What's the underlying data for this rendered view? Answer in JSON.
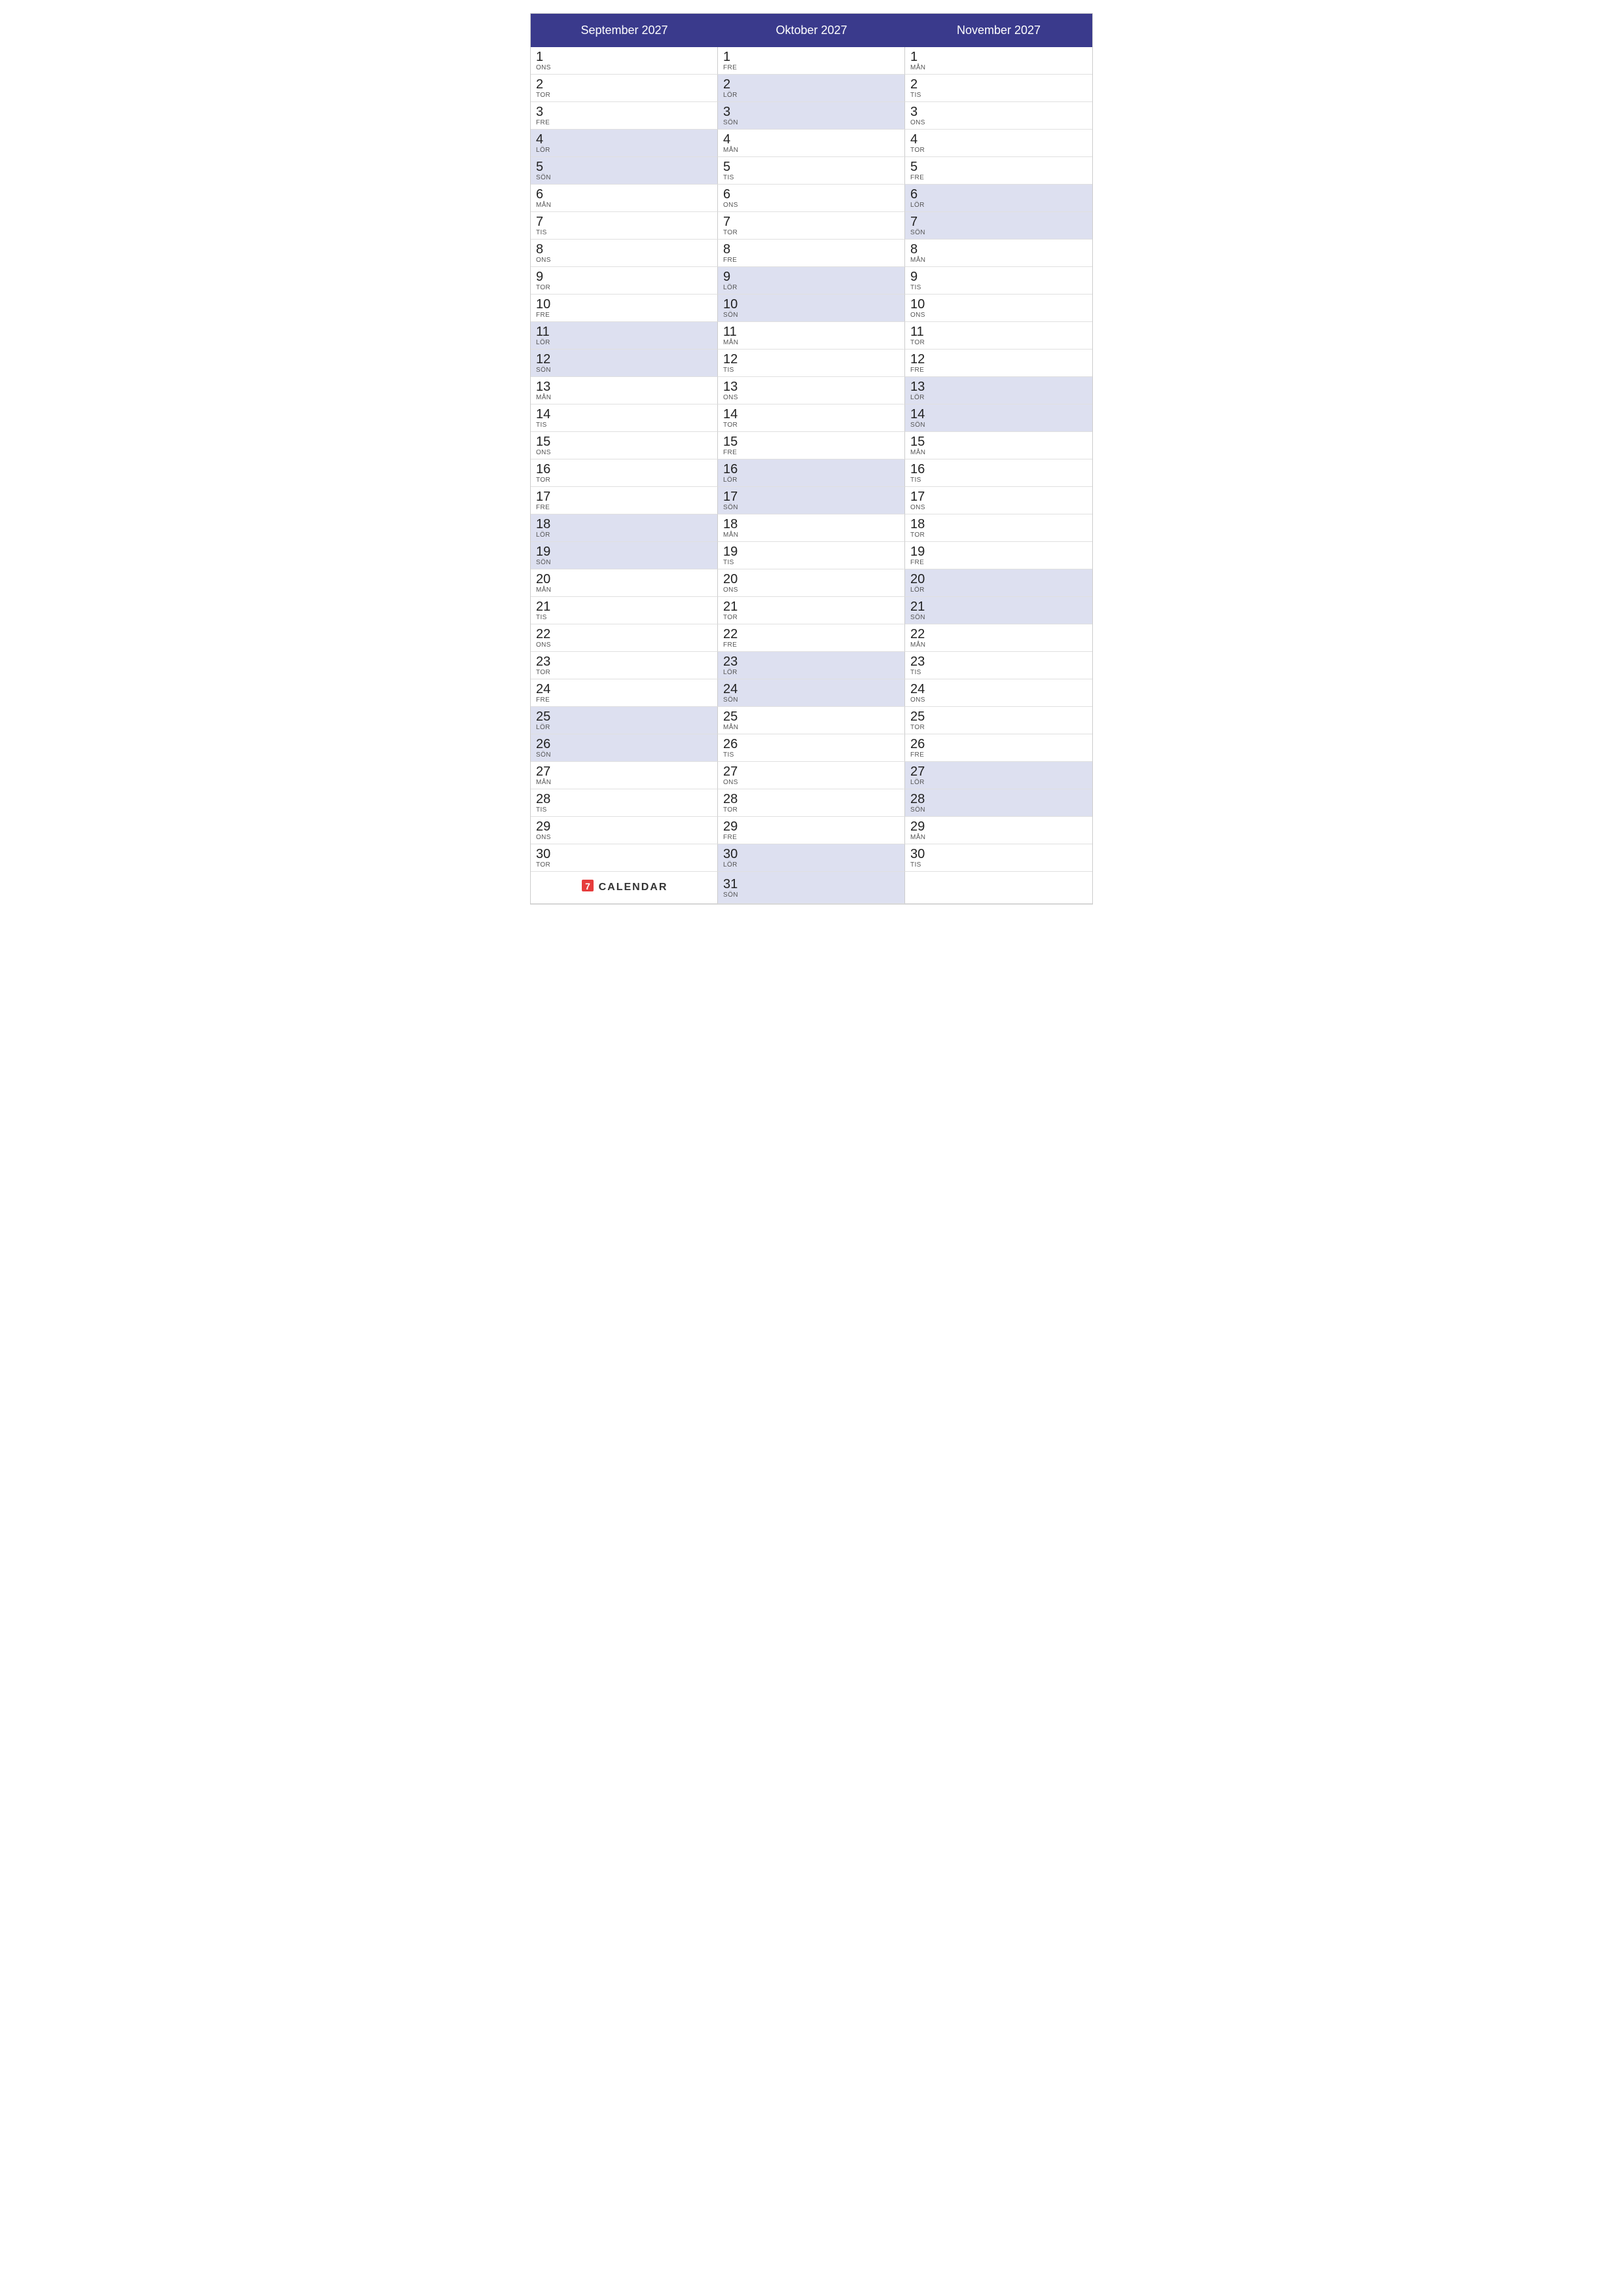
{
  "months": [
    {
      "name": "September 2027",
      "days": [
        {
          "num": "1",
          "day": "ONS",
          "weekend": false
        },
        {
          "num": "2",
          "day": "TOR",
          "weekend": false
        },
        {
          "num": "3",
          "day": "FRE",
          "weekend": false
        },
        {
          "num": "4",
          "day": "LÖR",
          "weekend": true
        },
        {
          "num": "5",
          "day": "SÖN",
          "weekend": true
        },
        {
          "num": "6",
          "day": "MÅN",
          "weekend": false
        },
        {
          "num": "7",
          "day": "TIS",
          "weekend": false
        },
        {
          "num": "8",
          "day": "ONS",
          "weekend": false
        },
        {
          "num": "9",
          "day": "TOR",
          "weekend": false
        },
        {
          "num": "10",
          "day": "FRE",
          "weekend": false
        },
        {
          "num": "11",
          "day": "LÖR",
          "weekend": true
        },
        {
          "num": "12",
          "day": "SÖN",
          "weekend": true
        },
        {
          "num": "13",
          "day": "MÅN",
          "weekend": false
        },
        {
          "num": "14",
          "day": "TIS",
          "weekend": false
        },
        {
          "num": "15",
          "day": "ONS",
          "weekend": false
        },
        {
          "num": "16",
          "day": "TOR",
          "weekend": false
        },
        {
          "num": "17",
          "day": "FRE",
          "weekend": false
        },
        {
          "num": "18",
          "day": "LÖR",
          "weekend": true
        },
        {
          "num": "19",
          "day": "SÖN",
          "weekend": true
        },
        {
          "num": "20",
          "day": "MÅN",
          "weekend": false
        },
        {
          "num": "21",
          "day": "TIS",
          "weekend": false
        },
        {
          "num": "22",
          "day": "ONS",
          "weekend": false
        },
        {
          "num": "23",
          "day": "TOR",
          "weekend": false
        },
        {
          "num": "24",
          "day": "FRE",
          "weekend": false
        },
        {
          "num": "25",
          "day": "LÖR",
          "weekend": true
        },
        {
          "num": "26",
          "day": "SÖN",
          "weekend": true
        },
        {
          "num": "27",
          "day": "MÅN",
          "weekend": false
        },
        {
          "num": "28",
          "day": "TIS",
          "weekend": false
        },
        {
          "num": "29",
          "day": "ONS",
          "weekend": false
        },
        {
          "num": "30",
          "day": "TOR",
          "weekend": false
        }
      ]
    },
    {
      "name": "Oktober 2027",
      "days": [
        {
          "num": "1",
          "day": "FRE",
          "weekend": false
        },
        {
          "num": "2",
          "day": "LÖR",
          "weekend": true
        },
        {
          "num": "3",
          "day": "SÖN",
          "weekend": true
        },
        {
          "num": "4",
          "day": "MÅN",
          "weekend": false
        },
        {
          "num": "5",
          "day": "TIS",
          "weekend": false
        },
        {
          "num": "6",
          "day": "ONS",
          "weekend": false
        },
        {
          "num": "7",
          "day": "TOR",
          "weekend": false
        },
        {
          "num": "8",
          "day": "FRE",
          "weekend": false
        },
        {
          "num": "9",
          "day": "LÖR",
          "weekend": true
        },
        {
          "num": "10",
          "day": "SÖN",
          "weekend": true
        },
        {
          "num": "11",
          "day": "MÅN",
          "weekend": false
        },
        {
          "num": "12",
          "day": "TIS",
          "weekend": false
        },
        {
          "num": "13",
          "day": "ONS",
          "weekend": false
        },
        {
          "num": "14",
          "day": "TOR",
          "weekend": false
        },
        {
          "num": "15",
          "day": "FRE",
          "weekend": false
        },
        {
          "num": "16",
          "day": "LÖR",
          "weekend": true
        },
        {
          "num": "17",
          "day": "SÖN",
          "weekend": true
        },
        {
          "num": "18",
          "day": "MÅN",
          "weekend": false
        },
        {
          "num": "19",
          "day": "TIS",
          "weekend": false
        },
        {
          "num": "20",
          "day": "ONS",
          "weekend": false
        },
        {
          "num": "21",
          "day": "TOR",
          "weekend": false
        },
        {
          "num": "22",
          "day": "FRE",
          "weekend": false
        },
        {
          "num": "23",
          "day": "LÖR",
          "weekend": true
        },
        {
          "num": "24",
          "day": "SÖN",
          "weekend": true
        },
        {
          "num": "25",
          "day": "MÅN",
          "weekend": false
        },
        {
          "num": "26",
          "day": "TIS",
          "weekend": false
        },
        {
          "num": "27",
          "day": "ONS",
          "weekend": false
        },
        {
          "num": "28",
          "day": "TOR",
          "weekend": false
        },
        {
          "num": "29",
          "day": "FRE",
          "weekend": false
        },
        {
          "num": "30",
          "day": "LÖR",
          "weekend": true
        },
        {
          "num": "31",
          "day": "SÖN",
          "weekend": true
        }
      ]
    },
    {
      "name": "November 2027",
      "days": [
        {
          "num": "1",
          "day": "MÅN",
          "weekend": false
        },
        {
          "num": "2",
          "day": "TIS",
          "weekend": false
        },
        {
          "num": "3",
          "day": "ONS",
          "weekend": false
        },
        {
          "num": "4",
          "day": "TOR",
          "weekend": false
        },
        {
          "num": "5",
          "day": "FRE",
          "weekend": false
        },
        {
          "num": "6",
          "day": "LÖR",
          "weekend": true
        },
        {
          "num": "7",
          "day": "SÖN",
          "weekend": true
        },
        {
          "num": "8",
          "day": "MÅN",
          "weekend": false
        },
        {
          "num": "9",
          "day": "TIS",
          "weekend": false
        },
        {
          "num": "10",
          "day": "ONS",
          "weekend": false
        },
        {
          "num": "11",
          "day": "TOR",
          "weekend": false
        },
        {
          "num": "12",
          "day": "FRE",
          "weekend": false
        },
        {
          "num": "13",
          "day": "LÖR",
          "weekend": true
        },
        {
          "num": "14",
          "day": "SÖN",
          "weekend": true
        },
        {
          "num": "15",
          "day": "MÅN",
          "weekend": false
        },
        {
          "num": "16",
          "day": "TIS",
          "weekend": false
        },
        {
          "num": "17",
          "day": "ONS",
          "weekend": false
        },
        {
          "num": "18",
          "day": "TOR",
          "weekend": false
        },
        {
          "num": "19",
          "day": "FRE",
          "weekend": false
        },
        {
          "num": "20",
          "day": "LÖR",
          "weekend": true
        },
        {
          "num": "21",
          "day": "SÖN",
          "weekend": true
        },
        {
          "num": "22",
          "day": "MÅN",
          "weekend": false
        },
        {
          "num": "23",
          "day": "TIS",
          "weekend": false
        },
        {
          "num": "24",
          "day": "ONS",
          "weekend": false
        },
        {
          "num": "25",
          "day": "TOR",
          "weekend": false
        },
        {
          "num": "26",
          "day": "FRE",
          "weekend": false
        },
        {
          "num": "27",
          "day": "LÖR",
          "weekend": true
        },
        {
          "num": "28",
          "day": "SÖN",
          "weekend": true
        },
        {
          "num": "29",
          "day": "MÅN",
          "weekend": false
        },
        {
          "num": "30",
          "day": "TIS",
          "weekend": false
        }
      ]
    }
  ],
  "logo": {
    "icon": "7",
    "text": "CALENDAR"
  }
}
